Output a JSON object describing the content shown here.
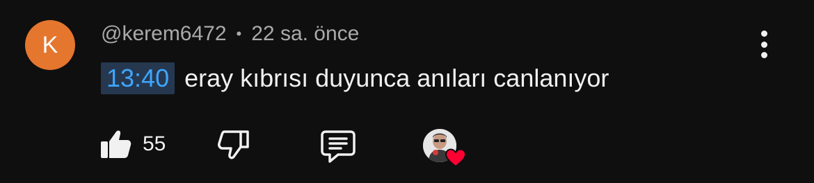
{
  "comment": {
    "avatar_letter": "K",
    "author": "@kerem6472",
    "separator": "•",
    "time": "22 sa. önce",
    "timestamp_link": "13:40",
    "text": "eray kıbrısı duyunca anıları canlanıyor"
  },
  "actions": {
    "like_count": "55"
  },
  "colors": {
    "background": "#0f0f0f",
    "avatar": "#e5762e",
    "timestamp_text": "#3ea6ff",
    "timestamp_bg": "#263850",
    "heart": "#ff0033"
  },
  "icons": [
    "more-vertical-icon",
    "like-icon",
    "dislike-icon",
    "reply-icon",
    "creator-heart-icon"
  ]
}
